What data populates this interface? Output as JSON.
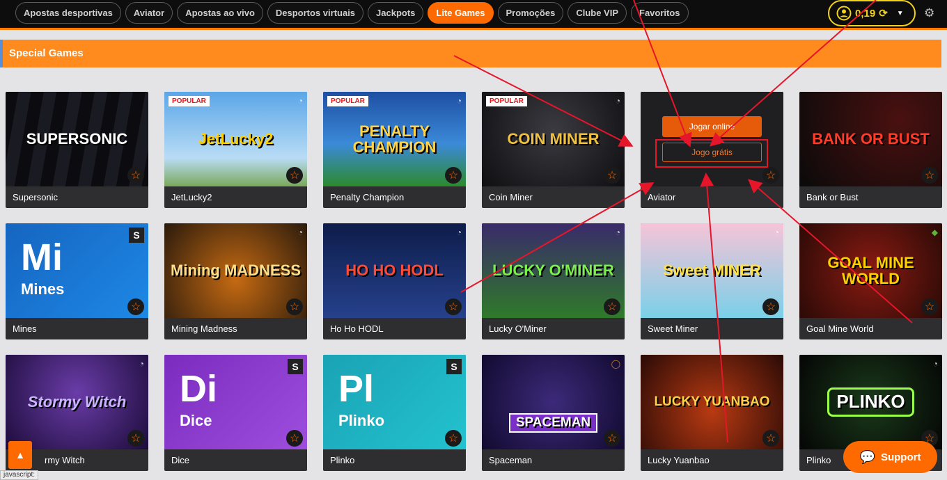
{
  "nav": {
    "items": [
      "Apostas desportivas",
      "Aviator",
      "Apostas ao vivo",
      "Desportos virtuais",
      "Jackpots",
      "Lite Games",
      "Promoções",
      "Clube VIP",
      "Favoritos"
    ],
    "active": "Lite Games"
  },
  "account": {
    "balance": "0,19"
  },
  "section": {
    "title": "Special Games"
  },
  "badges": {
    "popular": "POPULAR",
    "s": "S"
  },
  "cards": [
    {
      "name": "Supersonic",
      "art": "SUPERSONIC"
    },
    {
      "name": "JetLucky2",
      "art": "JetLucky2"
    },
    {
      "name": "Penalty Champion",
      "art": "PENALTY CHAMPION"
    },
    {
      "name": "Coin Miner",
      "art": "COIN MINER"
    },
    {
      "name": "Aviator"
    },
    {
      "name": "Bank or Bust",
      "art": "BANK OR BUST"
    },
    {
      "name": "Mines",
      "letters": "Mi",
      "sub": "Mines"
    },
    {
      "name": "Mining Madness",
      "art": "Mining MADNESS"
    },
    {
      "name": "Ho Ho HODL",
      "art": "HO HO HODL"
    },
    {
      "name": "Lucky O'Miner",
      "art": "LUCKY O'MINER"
    },
    {
      "name": "Sweet Miner",
      "art": "Sweet MINER"
    },
    {
      "name": "Goal Mine World",
      "art": "GOAL MINE WORLD"
    },
    {
      "name": "rmy Witch",
      "art": "Stormy Witch"
    },
    {
      "name": "Dice",
      "letters": "Di",
      "sub": "Dice"
    },
    {
      "name": "Plinko",
      "letters": "Pl",
      "sub": "Plinko"
    },
    {
      "name": "Spaceman",
      "art": "SPACEMAN"
    },
    {
      "name": "Lucky Yuanbao",
      "art": "LUCKY YUANBAO"
    },
    {
      "name": "Plinko",
      "art": "PLINKO"
    }
  ],
  "aviator_actions": {
    "play_online": "Jogar online",
    "play_free": "Jogo grátis"
  },
  "support": {
    "label": "Support"
  },
  "status": {
    "text": "javascript:"
  },
  "colors": {
    "accent": "#ff6a00",
    "balance": "#f2d21b",
    "annotation": "#e5162a"
  }
}
